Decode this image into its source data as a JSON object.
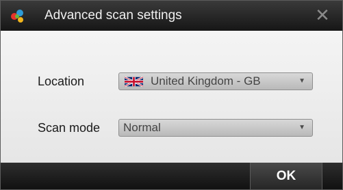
{
  "dialog": {
    "title": "Advanced scan settings",
    "app_icon": "app-logo-icon",
    "close_glyph": "✕"
  },
  "form": {
    "location": {
      "label": "Location",
      "value": "United Kingdom - GB",
      "flag": "uk-flag-icon"
    },
    "scan_mode": {
      "label": "Scan mode",
      "value": "Normal"
    },
    "dropdown_glyph": "▼"
  },
  "footer": {
    "ok_label": "OK"
  },
  "colors": {
    "titlebar": "#1e1e1e",
    "body": "#ececec",
    "footer": "#1a1a1a",
    "select_fill": "#c8c8c8"
  }
}
